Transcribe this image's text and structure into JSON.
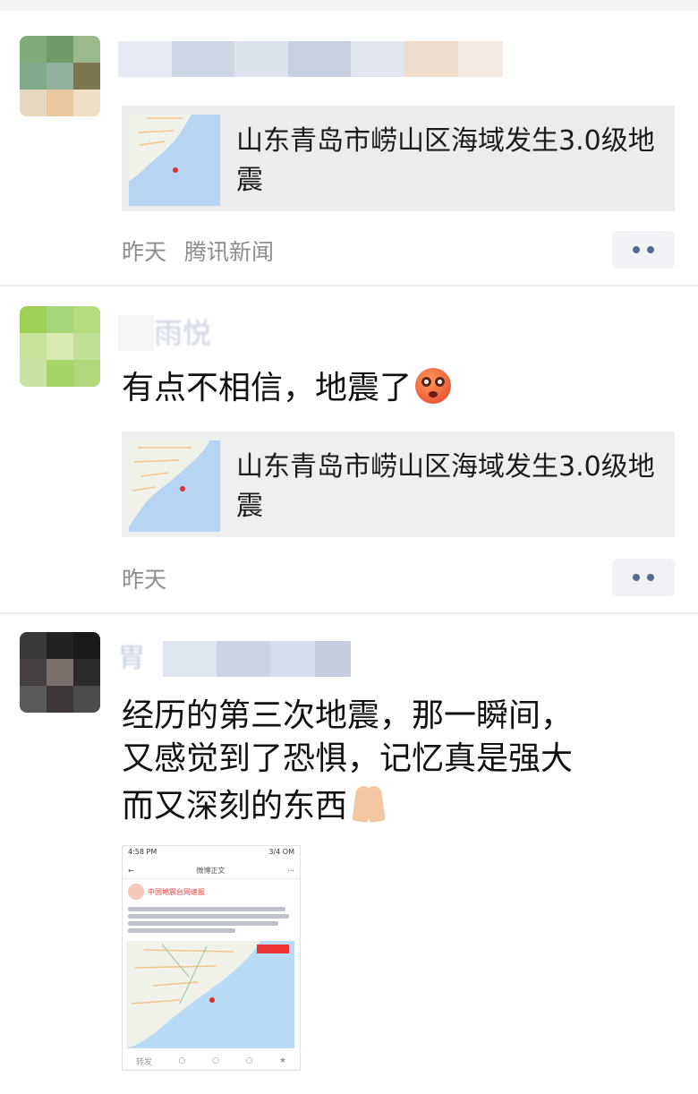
{
  "posts": [
    {
      "link_title": "山东青岛市崂山区海域发生3.0级地震",
      "time": "昨天",
      "source": "腾讯新闻",
      "more_icon": "more-dots-icon"
    },
    {
      "name_partial": "雨悦",
      "text": "有点不相信，地震了",
      "emoji_icon": "flushed-face-emoji-icon",
      "link_title": "山东青岛市崂山区海域发生3.0级地震",
      "time": "昨天",
      "more_icon": "more-dots-icon"
    },
    {
      "name_partial": "胃",
      "text_lines": [
        "经历的第三次地震，那一瞬间，",
        "又感觉到了恐惧，记忆真是强大",
        "而又深刻的东西"
      ],
      "emoji_icon": "folded-hands-emoji-icon",
      "screenshot": {
        "status_left": "4:58 PM",
        "status_right": "3/4 OM",
        "nav_title": "微博正文",
        "account": "中国地震台网速报",
        "bottom_left": "转发"
      }
    }
  ],
  "colors": {
    "link_card_bg": "#ececec",
    "meta_text": "#8d8d8d",
    "more_dot": "#556a8d"
  }
}
